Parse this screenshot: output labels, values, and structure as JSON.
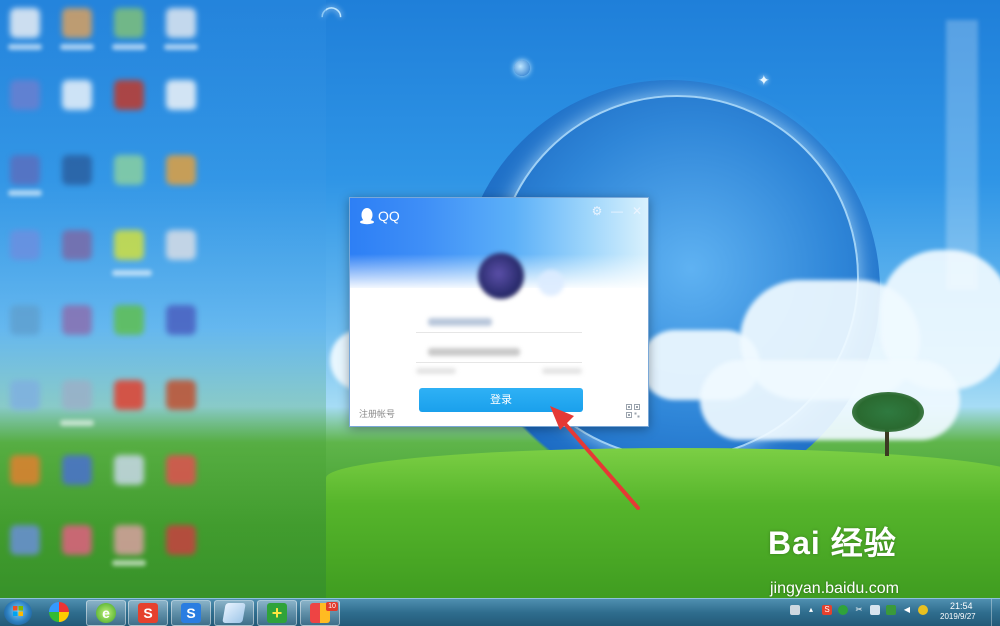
{
  "window": {
    "app_title": "QQ",
    "login_button_label": "登录",
    "register_link_label": "注册帐号"
  },
  "taskbar": {
    "items": [
      {
        "name": "start-menu",
        "icon": "windows-logo-icon"
      },
      {
        "name": "pinwheel-app",
        "icon": "pinwheel-icon"
      },
      {
        "name": "360-browser",
        "icon": "green-browser-icon"
      },
      {
        "name": "wps-app",
        "icon": "red-s-icon",
        "glyph": "S"
      },
      {
        "name": "sogou-input",
        "icon": "blue-s-icon",
        "glyph": "S"
      },
      {
        "name": "notepad-app",
        "icon": "notepad-icon"
      },
      {
        "name": "360-security",
        "icon": "green-plus-icon",
        "glyph": "+"
      },
      {
        "name": "app-with-badge",
        "icon": "colorful-grid-icon",
        "badge": "10"
      }
    ],
    "clock": {
      "time": "21:54",
      "date": "2019/9/27"
    }
  },
  "watermark": {
    "logo_text": "Bai  经验",
    "url": "jingyan.baidu.com"
  },
  "colors": {
    "login_button": "#1aa0ec",
    "qq_header": "#2d7ff5",
    "arrow": "#e53935",
    "taskbar": "#2f6d8e"
  }
}
